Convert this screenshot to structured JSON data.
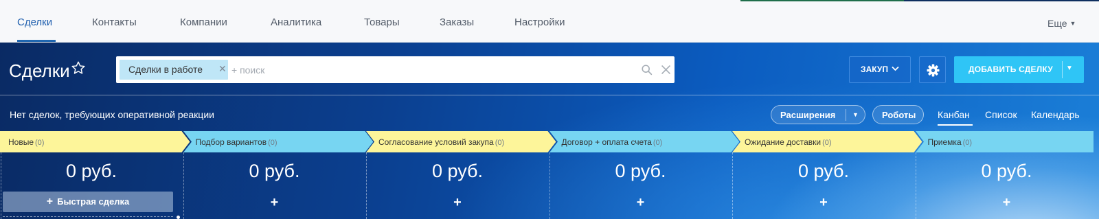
{
  "topnav": {
    "items": [
      {
        "label": "Сделки",
        "active": true
      },
      {
        "label": "Контакты"
      },
      {
        "label": "Компании"
      },
      {
        "label": "Аналитика"
      },
      {
        "label": "Товары"
      },
      {
        "label": "Заказы"
      },
      {
        "label": "Настройки"
      }
    ],
    "more_label": "Еще"
  },
  "header": {
    "title": "Сделки",
    "filter": {
      "chip_label": "Сделки в работе",
      "search_placeholder": "+ поиск"
    },
    "category_button": "ЗАКУП",
    "add_button": "ДОБАВИТЬ СДЕЛКУ"
  },
  "subbar": {
    "info": "Нет сделок, требующих оперативной реакции",
    "extensions_label": "Расширения",
    "robots_label": "Роботы",
    "views": [
      "Канбан",
      "Список",
      "Календарь"
    ],
    "active_view": "Канбан"
  },
  "stages": [
    {
      "name": "Новые",
      "count": "(0)",
      "sum": "0 руб.",
      "color": "#fdf59a"
    },
    {
      "name": "Подбор вариантов",
      "count": "(0)",
      "sum": "0 руб.",
      "color": "#77d5f2"
    },
    {
      "name": "Согласование условий закупа",
      "count": "(0)",
      "sum": "0 руб.",
      "color": "#fdf59a"
    },
    {
      "name": "Договор + оплата счета",
      "count": "(0)",
      "sum": "0 руб.",
      "color": "#77d5f2"
    },
    {
      "name": "Ожидание доставки",
      "count": "(0)",
      "sum": "0 руб.",
      "color": "#fdf59a"
    },
    {
      "name": "Приемка",
      "count": "(0)",
      "sum": "0 руб.",
      "color": "#77d5f2"
    }
  ],
  "quick_deal_label": "Быстрая сделка",
  "icons": {
    "star": "star-outline-icon",
    "search": "search-icon",
    "clear": "close-icon",
    "gear": "gear-icon",
    "chip_close": "close-icon"
  },
  "colors": {
    "accent": "#2067b0",
    "add_button": "#2fc5f6"
  }
}
